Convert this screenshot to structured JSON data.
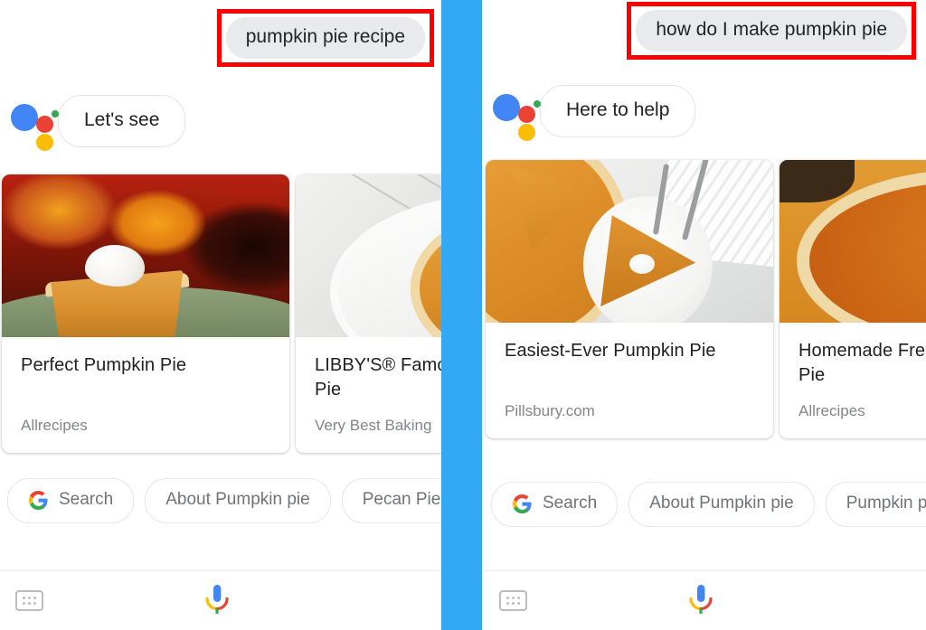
{
  "app": {
    "name": "Google Assistant",
    "divider_color": "#33a8f5",
    "highlight_color": "#fb0000"
  },
  "panels": [
    {
      "id": "left",
      "query": {
        "text": "pumpkin pie recipe",
        "highlighted": true
      },
      "assistant": {
        "logo": "google-assistant-logo",
        "reply": "Let's see"
      },
      "cards": [
        {
          "title": "Perfect Pumpkin Pie",
          "source": "Allrecipes",
          "image": "pumpkin-pie-slice-whipped-cream-on-green-plate"
        },
        {
          "title": "LIBBY'S® Famous Pumpkin Pie",
          "source": "Very Best Baking",
          "image": "pumpkin-pie-slice-on-white-plate-marble"
        }
      ],
      "chips": [
        {
          "label": "Search",
          "icon": "google-g-icon"
        },
        {
          "label": "About Pumpkin pie",
          "icon": null
        },
        {
          "label": "Pecan Pie recipe",
          "icon": null
        }
      ],
      "bottom_bar": {
        "keyboard_icon": "keyboard-icon",
        "mic_icon": "google-mic-icon"
      }
    },
    {
      "id": "right",
      "query": {
        "text": "how do I make pumpkin pie",
        "highlighted": true
      },
      "assistant": {
        "logo": "google-assistant-logo",
        "reply": "Here to help"
      },
      "cards": [
        {
          "title": "Easiest-Ever Pumpkin Pie",
          "source": "Pillsbury.com",
          "image": "pumpkin-pie-with-slice-on-plate-and-forks"
        },
        {
          "title": "Homemade Fresh Pumpkin Pie",
          "source": "Allrecipes",
          "image": "pumpkin-pie-with-pastry-leaf-decorations"
        }
      ],
      "chips": [
        {
          "label": "Search",
          "icon": "google-g-icon"
        },
        {
          "label": "About Pumpkin pie",
          "icon": null
        },
        {
          "label": "Pumpkin pie recipe",
          "icon": null
        }
      ],
      "bottom_bar": {
        "keyboard_icon": "keyboard-icon",
        "mic_icon": "google-mic-icon"
      }
    }
  ]
}
